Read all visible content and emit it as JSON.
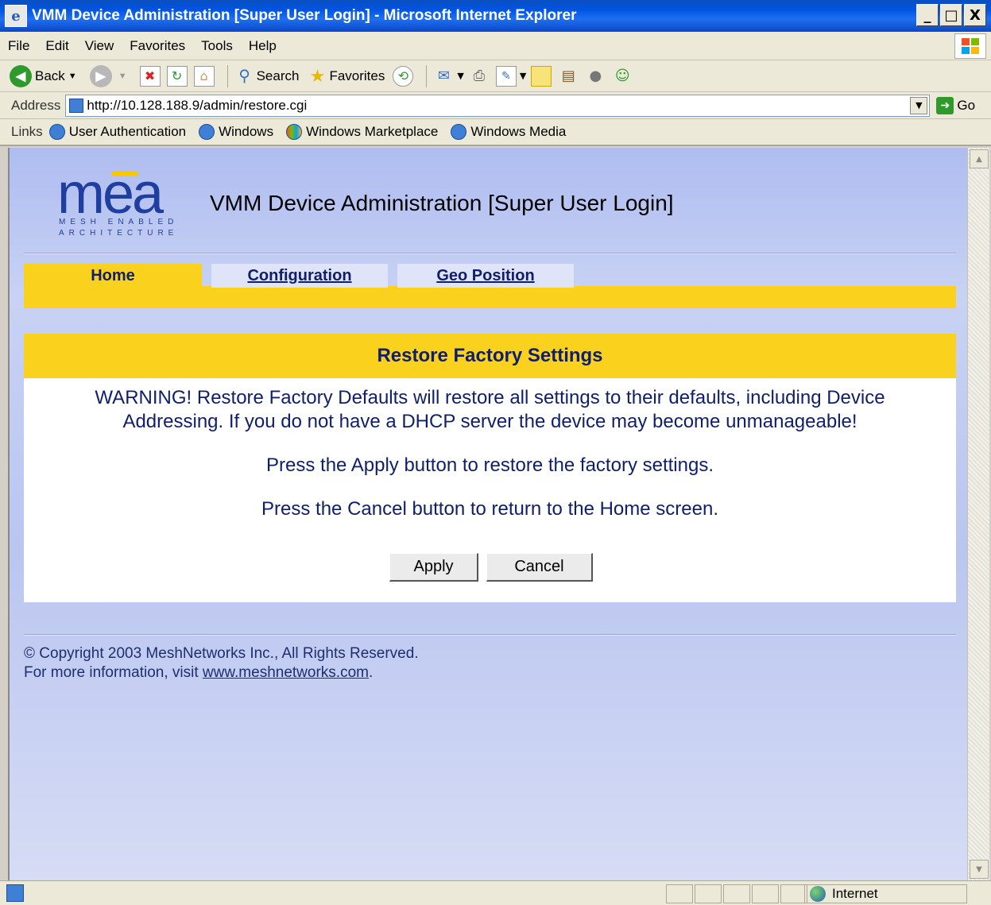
{
  "window": {
    "title": "VMM Device Administration [Super User Login] - Microsoft Internet Explorer",
    "controls": [
      "_",
      "□",
      "X"
    ]
  },
  "menu": [
    "File",
    "Edit",
    "View",
    "Favorites",
    "Tools",
    "Help"
  ],
  "toolbar": {
    "back_label": "Back",
    "search_label": "Search",
    "favorites_label": "Favorites"
  },
  "address": {
    "label": "Address",
    "url": "http://10.128.188.9/admin/restore.cgi",
    "go_label": "Go"
  },
  "links": {
    "label": "Links",
    "items": [
      "User Authentication",
      "Windows",
      "Windows Marketplace",
      "Windows Media"
    ]
  },
  "page": {
    "logo_text": "mea",
    "logo_line1": "MESH ENABLED",
    "logo_line2": "ARCHITECTURE",
    "heading": "VMM Device Administration [Super User Login]",
    "tabs": [
      "Home",
      "Configuration",
      "Geo Position"
    ],
    "panel_title": "Restore Factory Settings",
    "warning_line1": "WARNING! Restore Factory Defaults will restore all settings to their defaults, including Device",
    "warning_line2": "Addressing. If you do not have a DHCP server the device may become unmanageable!",
    "apply_text": "Press the Apply button to restore the factory settings.",
    "cancel_text": "Press the Cancel button to return to the Home screen.",
    "apply_button": "Apply",
    "cancel_button": "Cancel",
    "copyright": "© Copyright 2003 MeshNetworks Inc., All Rights Reserved.",
    "more_info_prefix": "For more information, visit ",
    "more_info_link": "www.meshnetworks.com",
    "more_info_suffix": "."
  },
  "status": {
    "zone": "Internet"
  },
  "colors": {
    "accent_yellow": "#fad21e",
    "text_navy": "#0f1f6a",
    "xp_blue": "#0054e3"
  }
}
